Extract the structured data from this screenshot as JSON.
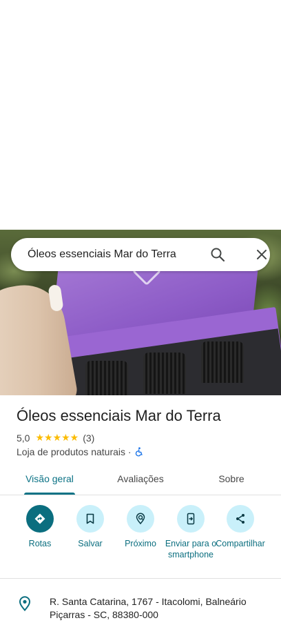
{
  "search": {
    "query": "Óleos essenciais Mar do Terra"
  },
  "place": {
    "title": "Óleos essenciais Mar do Terra",
    "rating": "5,0",
    "stars": "★★★★★",
    "review_count": "(3)",
    "category": "Loja de produtos naturais ·"
  },
  "tabs": [
    {
      "label": "Visão geral",
      "active": true
    },
    {
      "label": "Avaliações",
      "active": false
    },
    {
      "label": "Sobre",
      "active": false
    }
  ],
  "actions": [
    {
      "label": "Rotas",
      "icon": "directions-icon"
    },
    {
      "label": "Salvar",
      "icon": "bookmark-icon"
    },
    {
      "label": "Próximo",
      "icon": "nearby-icon"
    },
    {
      "label": "Enviar para o smartphone",
      "icon": "send-to-phone-icon"
    },
    {
      "label": "Compartilhar",
      "icon": "share-icon"
    }
  ],
  "address": {
    "text": "R. Santa Catarina, 1767 - Itacolomi, Balneário Piçarras - SC, 88380-000"
  },
  "colors": {
    "accent": "#0b6e7f",
    "action_bg": "#c9f0fa",
    "star": "#fbbc04",
    "box_purple": "#8d5cc7"
  }
}
